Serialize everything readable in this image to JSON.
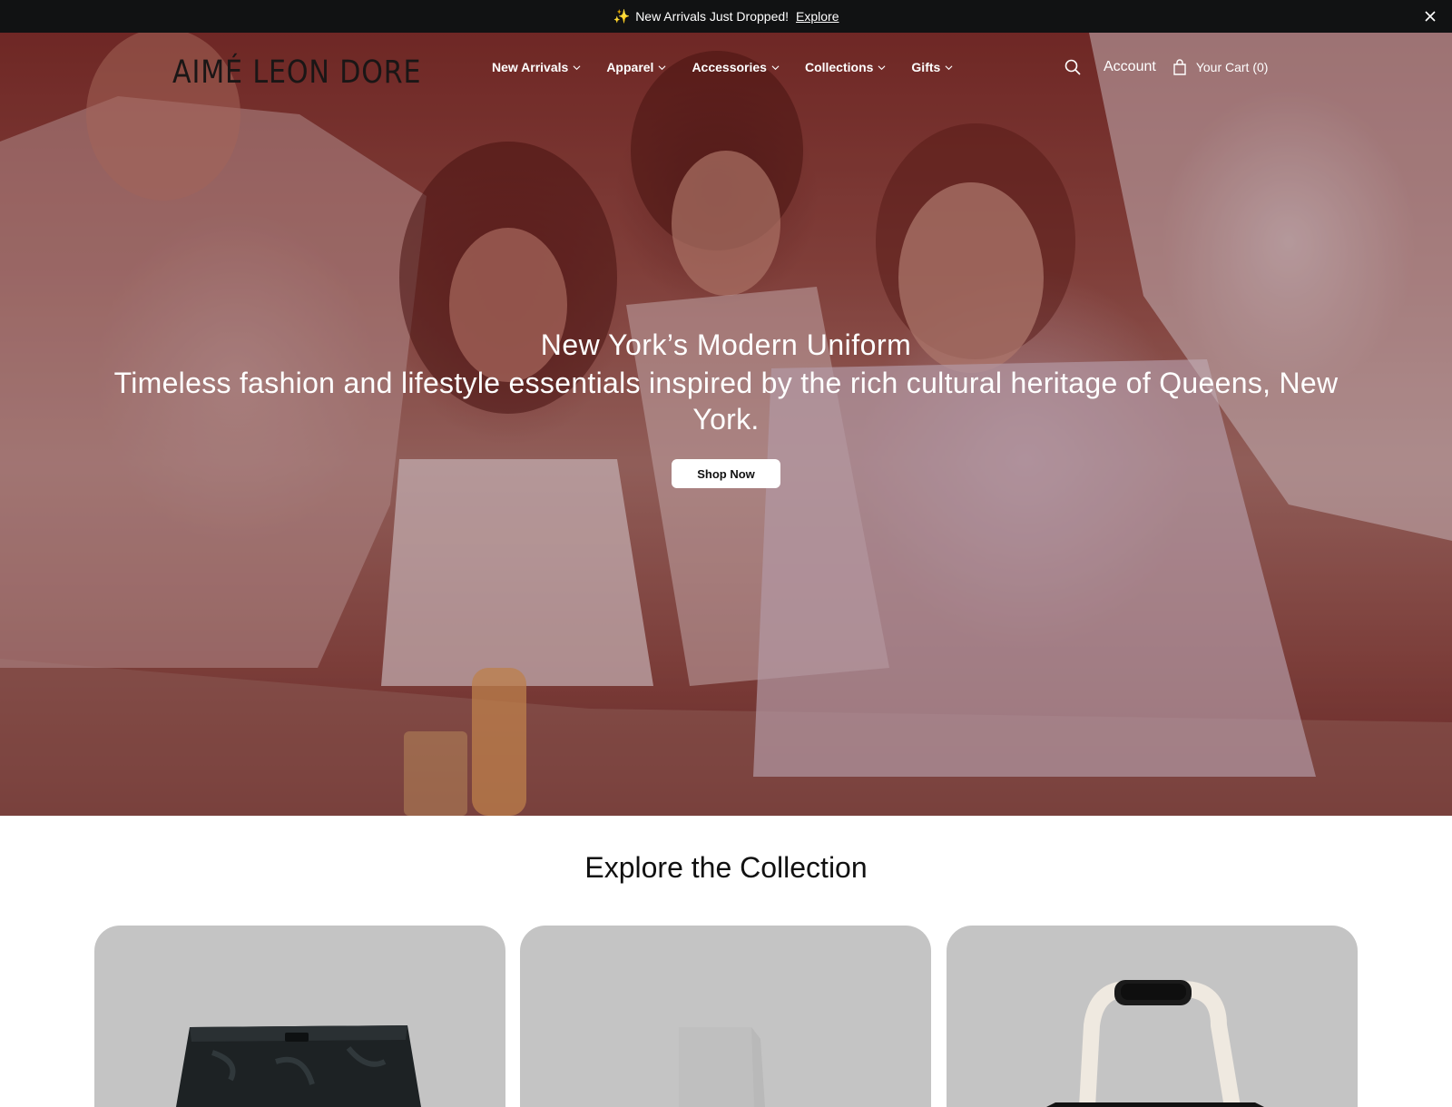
{
  "announcement": {
    "emoji": "✨",
    "text": "New Arrivals Just Dropped!",
    "link": "Explore",
    "close_icon": "close-icon"
  },
  "header": {
    "logo": "AIMÉ LEON DORE",
    "nav": [
      {
        "label": "New Arrivals",
        "icon": "chevron-down-icon"
      },
      {
        "label": "Apparel",
        "icon": "chevron-down-icon"
      },
      {
        "label": "Accessories",
        "icon": "chevron-down-icon"
      },
      {
        "label": "Collections",
        "icon": "chevron-down-icon"
      },
      {
        "label": "Gifts",
        "icon": "chevron-down-icon"
      }
    ],
    "search_icon": "search-icon",
    "account": "Account",
    "cart": "Your Cart (0)",
    "cart_icon": "shopping-bag-icon"
  },
  "hero": {
    "title": "New York’s Modern Uniform",
    "subtitle": "Timeless fashion and lifestyle essentials inspired by the rich cultural heritage of Queens, New York.",
    "cta": "Shop Now"
  },
  "collection": {
    "title": "Explore the Collection",
    "cards": [
      {
        "item": "shorts"
      },
      {
        "item": "socks"
      },
      {
        "item": "bag"
      }
    ]
  },
  "colors": {
    "topbar": "#111213",
    "card_bg": "#c4c4c4",
    "text": "#111111"
  }
}
